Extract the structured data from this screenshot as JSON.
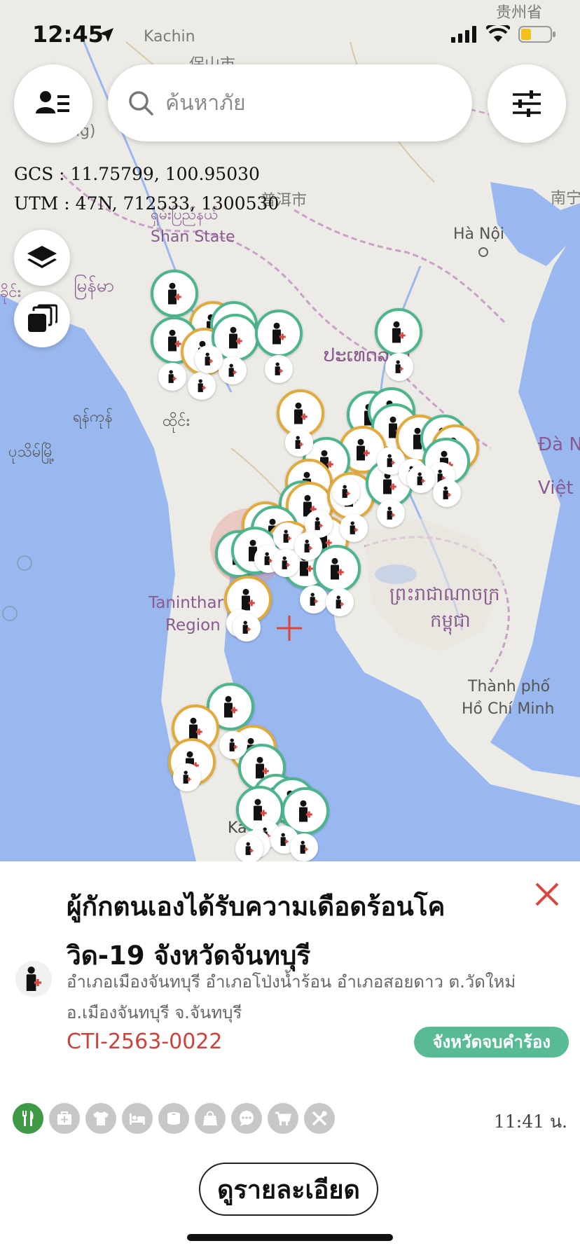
{
  "status_bar": {
    "time": "12:45"
  },
  "search": {
    "placeholder": "ค้นหาภัย"
  },
  "coordinates": {
    "gcs": "GCS : 11.75799, 100.95030",
    "utm": "UTM : 47N, 712533, 1300530"
  },
  "map": {
    "labels": {
      "kachin": "Kachin",
      "cn1": "保山市",
      "cn2": "普洱市",
      "cn3": "贵州省",
      "cn4": "南宁",
      "shan_my": "ရှမ်းပြည်နယ်",
      "shan": "Shan State",
      "myanmar": "မြန်မာ",
      "hanoi": "Hà Nội",
      "laos": "ປະເທດລາວ",
      "yangon": "ရန်ကုန်",
      "thai": "ထိုင်း",
      "bago": "ပုသိမ်မြို့",
      "danang": "Đà N",
      "vietnam": "Việt",
      "taninthar": "Taninthar",
      "region": "Region",
      "cambodia1": "ព្រះរាជាណាចក្រ",
      "cambodia2": "កម្ពុជា",
      "hcm1": "Thành phố",
      "hcm2": "Hồ Chí Minh",
      "left": "ခိုင်း",
      "ka": "Ka",
      "eng": "ng)"
    },
    "marker_colors": {
      "green": "#4db58c",
      "orange": "#e2a93b"
    }
  },
  "panel": {
    "title_line1": "ผู้กักตนเองได้รับความเดือดร้อนโค",
    "title_line2": "วิด-19 จังหวัดจันทบุรี",
    "address_line1": "อำเภอเมืองจันทบุรี อำเภอโป่งน้ำร้อน อำเภอสอยดาว ต.วัดใหม่",
    "address_line2": "อ.เมืองจันทบุรี จ.จันทบุรี",
    "code": "CTI-2563-0022",
    "status": "จังหวัดจบคำร้อง",
    "time": "11:41 น.",
    "detail_button": "ดูรายละเอียด",
    "need_icons": [
      "fork-knife-icon",
      "medical-kit-icon",
      "shirt-icon",
      "bed-icon",
      "toilet-paper-icon",
      "bag-icon",
      "chat-icon",
      "cart-icon",
      "tools-icon"
    ]
  }
}
